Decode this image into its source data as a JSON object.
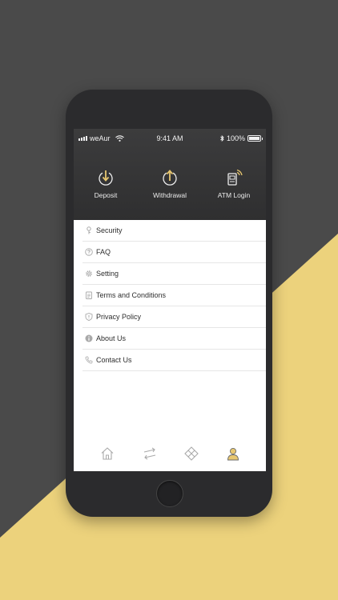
{
  "status_bar": {
    "carrier": "weAur",
    "time": "9:41 AM",
    "battery": "100%"
  },
  "header_actions": [
    {
      "label": "Deposit",
      "icon": "deposit-icon"
    },
    {
      "label": "Withdrawal",
      "icon": "withdrawal-icon"
    },
    {
      "label": "ATM Login",
      "icon": "atm-login-icon"
    }
  ],
  "menu": {
    "items": [
      {
        "label": "Security",
        "icon": "key-icon"
      },
      {
        "label": "FAQ",
        "icon": "question-bubble-icon"
      },
      {
        "label": "Setting",
        "icon": "gear-icon"
      },
      {
        "label": "Terms and Conditions",
        "icon": "document-icon"
      },
      {
        "label": "Privacy Policy",
        "icon": "shield-icon"
      },
      {
        "label": "About Us",
        "icon": "info-icon"
      },
      {
        "label": "Contact Us",
        "icon": "phone-icon"
      }
    ]
  },
  "tab_bar": {
    "tabs": [
      {
        "icon": "home-icon",
        "active": false
      },
      {
        "icon": "transfer-icon",
        "active": false
      },
      {
        "icon": "diamond-grid-icon",
        "active": false
      },
      {
        "icon": "profile-icon",
        "active": true
      }
    ]
  },
  "colors": {
    "accent": "#e8c770",
    "header_dark": "#353536",
    "background_dark": "#4a4a4a",
    "background_yellow": "#ecd27c",
    "icon_gray": "#a9a9a9"
  }
}
